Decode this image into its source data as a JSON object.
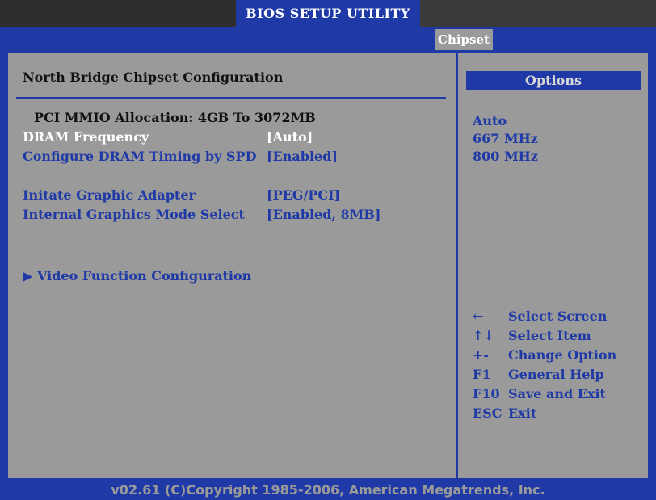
{
  "app": {
    "title": "BIOS SETUP UTILITY"
  },
  "menu": {
    "active_tab": "Chipset"
  },
  "main": {
    "heading": "North Bridge Chipset Configuration",
    "info_line": "PCI MMIO Allocation: 4GB To 3072MB",
    "items": [
      {
        "label": "DRAM Frequency",
        "value": "[Auto]",
        "selected": true
      },
      {
        "label": "Configure DRAM Timing by SPD",
        "value": "[Enabled]",
        "selected": false
      },
      {
        "label": "Initate Graphic Adapter",
        "value": "[PEG/PCI]",
        "selected": false
      },
      {
        "label": "Internal Graphics Mode Select",
        "value": "[Enabled, 8MB]",
        "selected": false
      }
    ],
    "submenu": {
      "icon": "▶",
      "label": "Video Function Configuration"
    }
  },
  "options": {
    "header": "Options",
    "list": [
      "Auto",
      "667 MHz",
      "800 MHz"
    ]
  },
  "help": [
    {
      "key": "←",
      "desc": "Select Screen"
    },
    {
      "key": "↑↓",
      "desc": "Select Item"
    },
    {
      "key": "+-",
      "desc": "Change Option"
    },
    {
      "key": "F1",
      "desc": "General Help"
    },
    {
      "key": "F10",
      "desc": "Save and Exit"
    },
    {
      "key": "ESC",
      "desc": "Exit"
    }
  ],
  "footer": {
    "copyright": "v02.61 (C)Copyright 1985-2006, American Megatrends, Inc."
  },
  "colors": {
    "blue": "#1f3aa6",
    "gray": "#9a9a9a",
    "white": "#ffffff"
  }
}
